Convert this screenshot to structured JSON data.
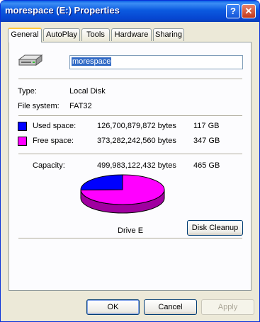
{
  "window": {
    "title": "morespace (E:) Properties",
    "help_glyph": "?",
    "close_glyph": "✕"
  },
  "tabs": [
    {
      "label": "General",
      "active": true
    },
    {
      "label": "AutoPlay"
    },
    {
      "label": "Tools"
    },
    {
      "label": "Hardware"
    },
    {
      "label": "Sharing"
    }
  ],
  "general": {
    "volume_name": "morespace",
    "type_label": "Type:",
    "type_value": "Local Disk",
    "fs_label": "File system:",
    "fs_value": "FAT32",
    "used_label": "Used space:",
    "used_bytes": "126,700,879,872 bytes",
    "used_gb": "117 GB",
    "used_color": "#0000ff",
    "free_label": "Free space:",
    "free_bytes": "373,282,242,560 bytes",
    "free_gb": "347 GB",
    "free_color": "#ff00ff",
    "capacity_label": "Capacity:",
    "capacity_bytes": "499,983,122,432 bytes",
    "capacity_gb": "465 GB",
    "used_fraction": 0.2534,
    "drive_label": "Drive E",
    "cleanup_button": "Disk Cleanup"
  },
  "buttons": {
    "ok": "OK",
    "cancel": "Cancel",
    "apply": "Apply"
  },
  "icons": {
    "drive": "hard-drive-icon"
  }
}
